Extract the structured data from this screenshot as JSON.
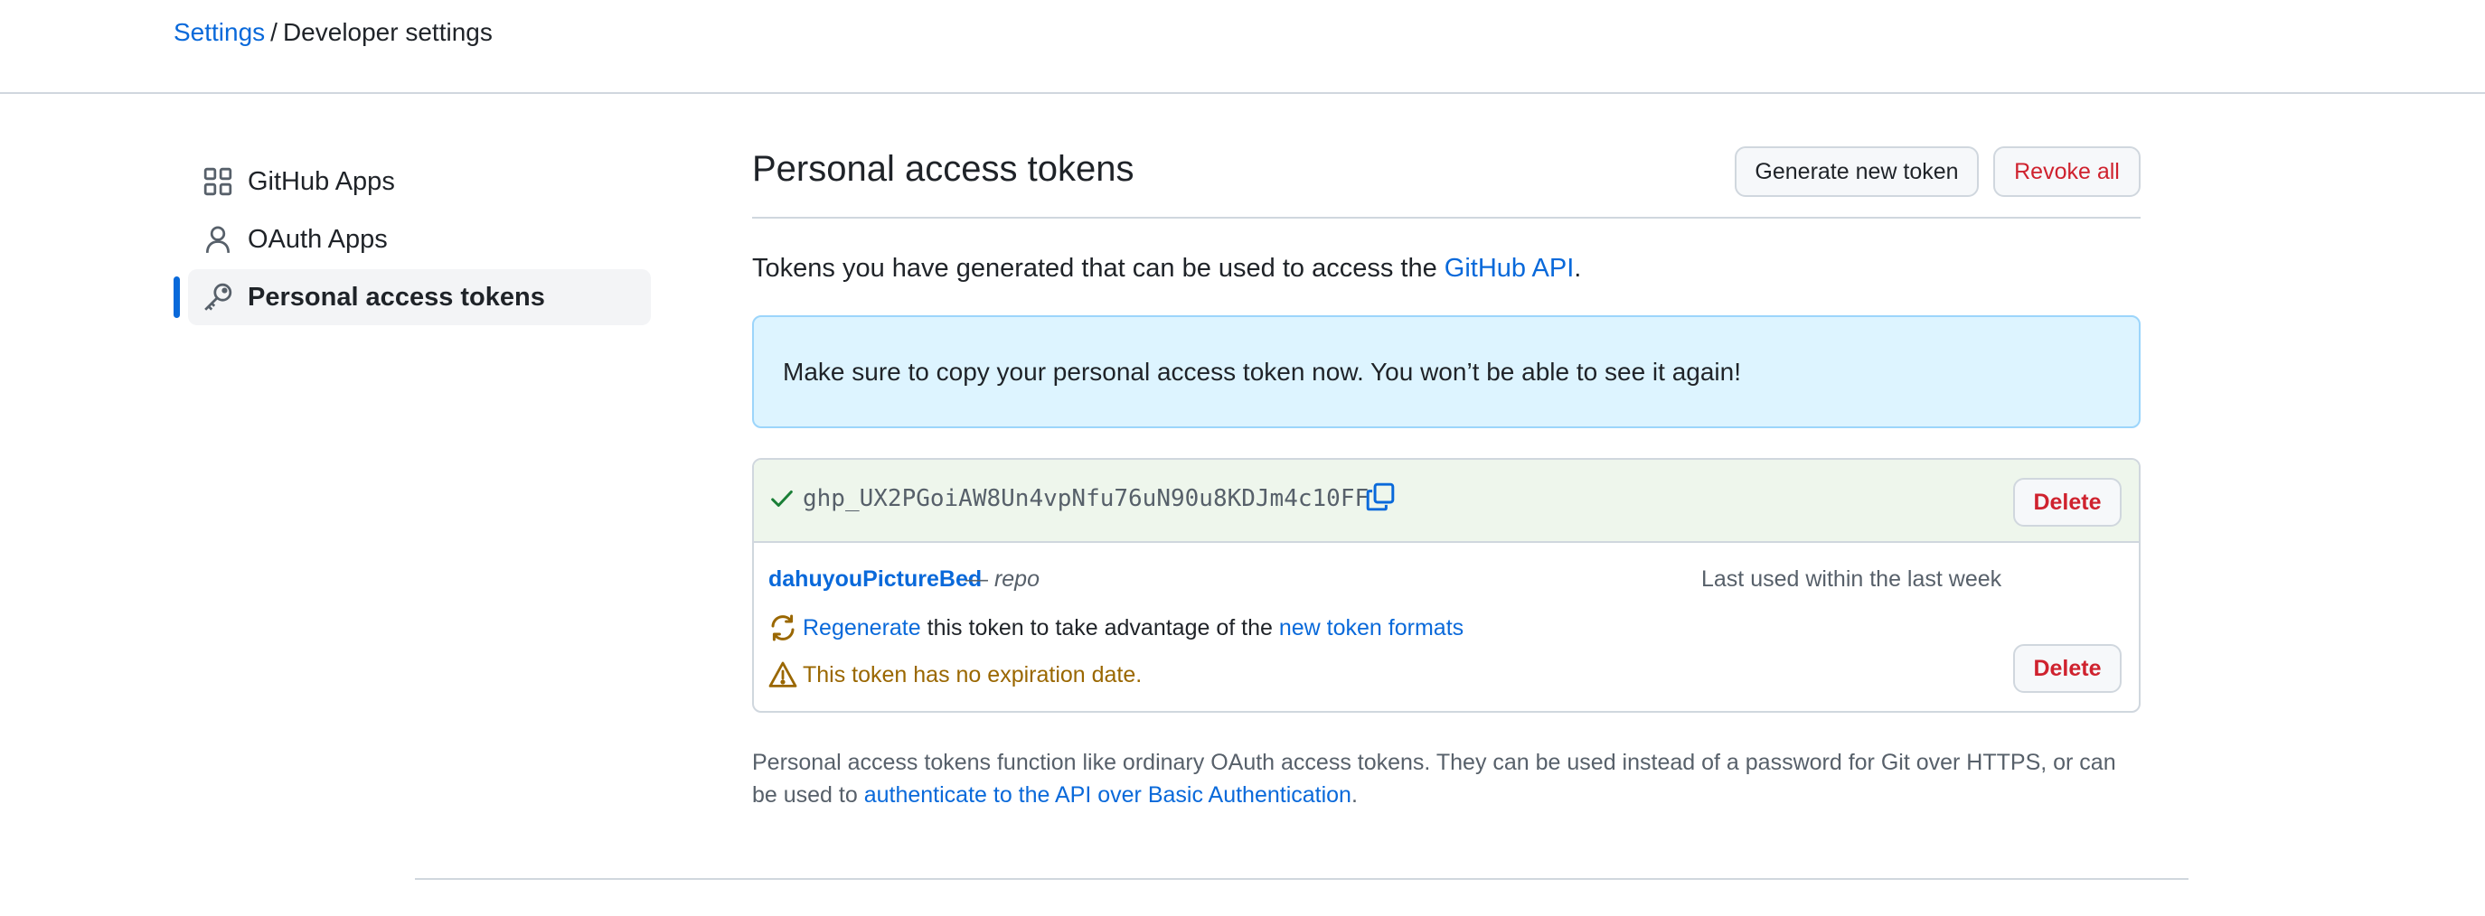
{
  "breadcrumb": {
    "root": "Settings",
    "separator": "/",
    "current": "Developer settings"
  },
  "sidebar": {
    "items": [
      {
        "label": "GitHub Apps",
        "icon": "apps-icon",
        "active": false
      },
      {
        "label": "OAuth Apps",
        "icon": "person-icon",
        "active": false
      },
      {
        "label": "Personal access tokens",
        "icon": "key-icon",
        "active": true
      }
    ]
  },
  "header": {
    "title": "Personal access tokens",
    "generate_label": "Generate new token",
    "revoke_label": "Revoke all"
  },
  "intro": {
    "text": "Tokens you have generated that can be used to access the ",
    "link": "GitHub API",
    "suffix": "."
  },
  "flash": {
    "message": "Make sure to copy your personal access token now. You won’t be able to see it again!"
  },
  "new_token": {
    "value": "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",
    "delete_label": "Delete"
  },
  "token": {
    "name": "dahuyouPictureBed",
    "dash": "—",
    "scope": "repo",
    "last_used": "Last used within the last week",
    "delete_label": "Delete",
    "regen_link": "Regenerate",
    "regen_text": "this token to take advantage of the",
    "formats_link": "new token formats",
    "warning": "This token has no expiration date."
  },
  "footnote": {
    "text": "Personal access tokens function like ordinary OAuth access tokens. They can be used instead of a password for Git over HTTPS, or can be used to ",
    "link": "authenticate to the API over Basic Authentication",
    "suffix": "."
  },
  "colors": {
    "accent": "#0969da",
    "danger": "#cf222e",
    "success": "#1a7f37",
    "attention": "#9a6700",
    "flash_bg": "#ddf4ff",
    "new_token_bg": "#eef6ec"
  }
}
